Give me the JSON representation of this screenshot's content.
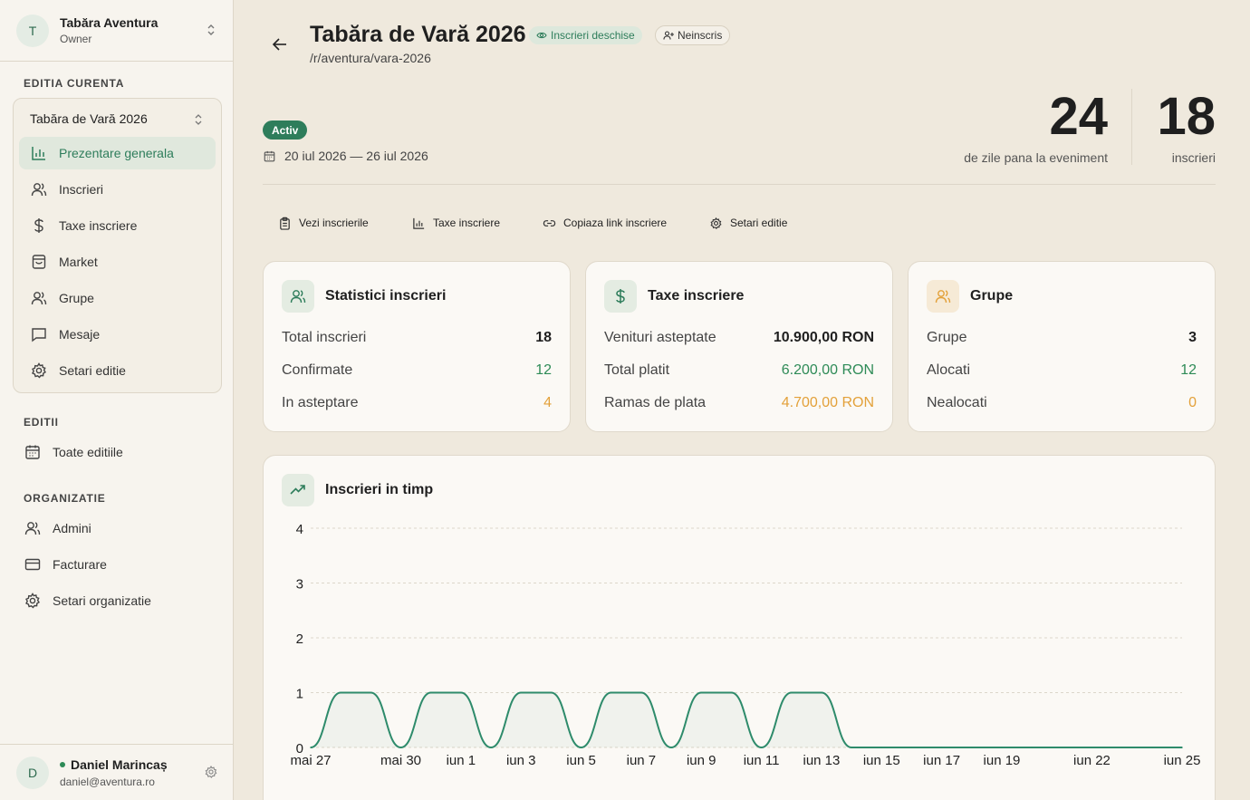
{
  "sidebar": {
    "org": {
      "initial": "T",
      "name": "Tabăra Aventura",
      "role": "Owner"
    },
    "current_edition_label": "EDITIA CURENTA",
    "edition_selected": "Tabăra de Vară 2026",
    "edition_nav": [
      {
        "label": "Prezentare generala",
        "icon": "bar-chart-icon",
        "active": true
      },
      {
        "label": "Inscrieri",
        "icon": "users-icon"
      },
      {
        "label": "Taxe inscriere",
        "icon": "dollar-icon"
      },
      {
        "label": "Market",
        "icon": "shopping-bag-icon"
      },
      {
        "label": "Grupe",
        "icon": "user-group-icon"
      },
      {
        "label": "Mesaje",
        "icon": "message-icon"
      },
      {
        "label": "Setari editie",
        "icon": "gear-icon"
      }
    ],
    "editions_label": "EDITII",
    "editions_nav": [
      {
        "label": "Toate editiile",
        "icon": "calendar-icon"
      }
    ],
    "organization_label": "ORGANIZATIE",
    "organization_nav": [
      {
        "label": "Admini",
        "icon": "users-icon"
      },
      {
        "label": "Facturare",
        "icon": "credit-card-icon"
      },
      {
        "label": "Setari organizatie",
        "icon": "gear-icon"
      }
    ],
    "user": {
      "initial": "D",
      "name": "Daniel Marincaș",
      "email": "daniel@aventura.ro"
    }
  },
  "header": {
    "title": "Tabăra de Vară 2026",
    "badge_open": "Inscrieri deschise",
    "badge_user": "Neinscris",
    "slug": "/r/aventura/vara-2026",
    "status": "Activ",
    "dates": "20 iul 2026 — 26 iul 2026",
    "days_value": "24",
    "days_label": "de zile pana la eveniment",
    "signups_value": "18",
    "signups_label": "inscrieri"
  },
  "actions": [
    {
      "label": "Vezi inscrierile",
      "icon": "clipboard-icon"
    },
    {
      "label": "Taxe inscriere",
      "icon": "bar-chart-icon"
    },
    {
      "label": "Copiaza link inscriere",
      "icon": "link-icon"
    },
    {
      "label": "Setari editie",
      "icon": "gear-icon"
    }
  ],
  "cards": {
    "stats": {
      "title": "Statistici inscrieri",
      "rows": [
        {
          "label": "Total inscrieri",
          "value": "18"
        },
        {
          "label": "Confirmate",
          "value": "12"
        },
        {
          "label": "In asteptare",
          "value": "4"
        }
      ]
    },
    "fees": {
      "title": "Taxe inscriere",
      "rows": [
        {
          "label": "Venituri asteptate",
          "value": "10.900,00 RON"
        },
        {
          "label": "Total platit",
          "value": "6.200,00 RON"
        },
        {
          "label": "Ramas de plata",
          "value": "4.700,00 RON"
        }
      ]
    },
    "groups": {
      "title": "Grupe",
      "rows": [
        {
          "label": "Grupe",
          "value": "3"
        },
        {
          "label": "Alocati",
          "value": "12"
        },
        {
          "label": "Nealocati",
          "value": "0"
        }
      ]
    }
  },
  "colors": {
    "accent": "#2e7d5b",
    "orange": "#e3a13a",
    "background": "#efe9dd"
  },
  "chart_data": {
    "type": "area",
    "title": "Inscrieri in timp",
    "xlabel": "",
    "ylabel": "",
    "ylim": [
      0,
      4
    ],
    "yticks": [
      0,
      1,
      2,
      3,
      4
    ],
    "grid": true,
    "x_tick_labels": [
      "mai 27",
      "mai 30",
      "iun 1",
      "iun 3",
      "iun 5",
      "iun 7",
      "iun 9",
      "iun 11",
      "iun 13",
      "iun 15",
      "iun 17",
      "iun 19",
      "iun 22",
      "iun 25"
    ],
    "x": [
      "mai 27",
      "mai 28",
      "mai 29",
      "mai 30",
      "mai 31",
      "iun 1",
      "iun 2",
      "iun 3",
      "iun 4",
      "iun 5",
      "iun 6",
      "iun 7",
      "iun 8",
      "iun 9",
      "iun 10",
      "iun 11",
      "iun 12",
      "iun 13",
      "iun 14",
      "iun 15",
      "iun 16",
      "iun 17",
      "iun 18",
      "iun 19",
      "iun 20",
      "iun 21",
      "iun 22",
      "iun 23",
      "iun 24",
      "iun 25"
    ],
    "series": [
      {
        "values": [
          0,
          1,
          1,
          0,
          1,
          1,
          0,
          1,
          1,
          0,
          1,
          1,
          0,
          1,
          1,
          0,
          1,
          1,
          0,
          0,
          0,
          0,
          0,
          0,
          0,
          0,
          0,
          0,
          0,
          0
        ]
      }
    ]
  }
}
